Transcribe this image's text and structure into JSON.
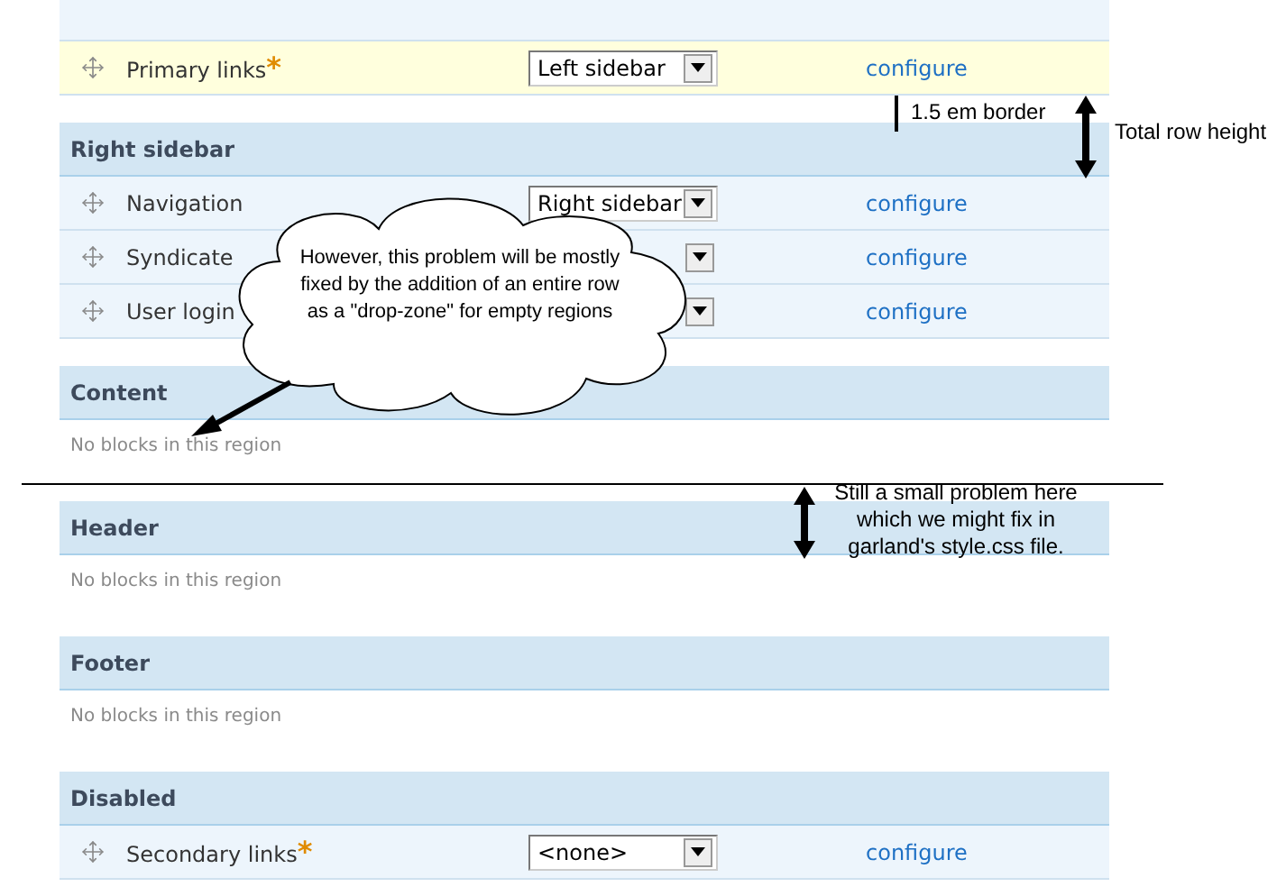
{
  "sections": [
    {
      "rows": [
        {
          "kind": "partial"
        },
        {
          "kind": "block",
          "name": "Primary links",
          "required_mark": "*",
          "highlighted": true,
          "region": "Left sidebar",
          "link": "configure"
        }
      ]
    },
    {
      "title": "Right sidebar",
      "rows": [
        {
          "kind": "block",
          "name": "Navigation",
          "highlighted": false,
          "region": "Right sidebar",
          "link": "configure"
        },
        {
          "kind": "block",
          "name": "Syndicate",
          "highlighted": false,
          "link": "configure"
        },
        {
          "kind": "block",
          "name": "User login",
          "highlighted": false,
          "link": "configure"
        }
      ]
    },
    {
      "title": "Content",
      "rows": [
        {
          "kind": "empty",
          "text": "No blocks in this region"
        }
      ]
    },
    {
      "title": "Header",
      "rows": [
        {
          "kind": "empty",
          "text": "No blocks in this region"
        }
      ]
    },
    {
      "title": "Footer",
      "rows": [
        {
          "kind": "empty",
          "text": "No blocks in this region"
        }
      ]
    },
    {
      "title": "Disabled",
      "rows": [
        {
          "kind": "block",
          "name": "Secondary links",
          "required_mark": "*",
          "highlighted": false,
          "region": "<none>",
          "link": "configure"
        }
      ]
    }
  ],
  "annotations": [
    {
      "kind": "border",
      "text": "1.5 em border"
    },
    {
      "kind": "height",
      "text": "Total row height"
    },
    {
      "kind": "cloud",
      "text": "However, this problem will be mostly fixed by the addition of an entire row as a \"drop-zone\" for empty regions"
    },
    {
      "kind": "divider"
    },
    {
      "kind": "problem",
      "text": "Still a small problem here which we might fix in garland's style.css file."
    }
  ]
}
